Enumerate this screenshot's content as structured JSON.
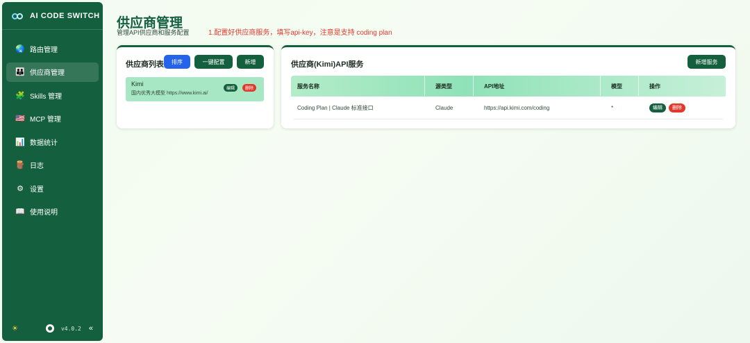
{
  "app": {
    "title": "AI CODE SWITCH",
    "version": "v4.0.2"
  },
  "sidebar": {
    "items": [
      {
        "label": "路由管理",
        "icon": "🌏"
      },
      {
        "label": "供应商管理",
        "icon": "👪"
      },
      {
        "label": "Skills 管理",
        "icon": "🧩"
      },
      {
        "label": "MCP 管理",
        "icon": "🇺🇸"
      },
      {
        "label": "数据统计",
        "icon": "📊"
      },
      {
        "label": "日志",
        "icon": "🪵"
      },
      {
        "label": "设置",
        "icon": "⚙"
      },
      {
        "label": "使用说明",
        "icon": "📖"
      }
    ],
    "active_index": 1,
    "footer": {
      "theme_icon": "☀",
      "collapse_icon": "«"
    }
  },
  "header": {
    "title": "供应商管理",
    "subtitle": "管理API供应商和服务配置",
    "note": "1.配置好供应商服务，填写api-key，注意是支持 coding plan"
  },
  "providers_panel": {
    "title": "供应商列表",
    "buttons": {
      "sort": "排序",
      "one_click": "一键配置",
      "add": "新增"
    },
    "providers": [
      {
        "name": "Kimi",
        "description": "国内优秀大模型 https://www.kimi.ai/",
        "edit": "编辑",
        "delete": "删除"
      }
    ]
  },
  "services_panel": {
    "title": "供应商(Kimi)API服务",
    "add_button": "新增服务",
    "columns": [
      "服务名称",
      "源类型",
      "API地址",
      "模型",
      "操作"
    ],
    "rows": [
      {
        "name": "Coding Plan | Claude 标准接口",
        "type": "Claude",
        "url": "https://api.kimi.com/coding",
        "model": "*",
        "edit": "编辑",
        "delete": "删除"
      }
    ]
  },
  "colors": {
    "primary": "#14603e",
    "accent_blue": "#2563eb",
    "danger": "#e0392b",
    "highlight": "#a8e7c4"
  }
}
